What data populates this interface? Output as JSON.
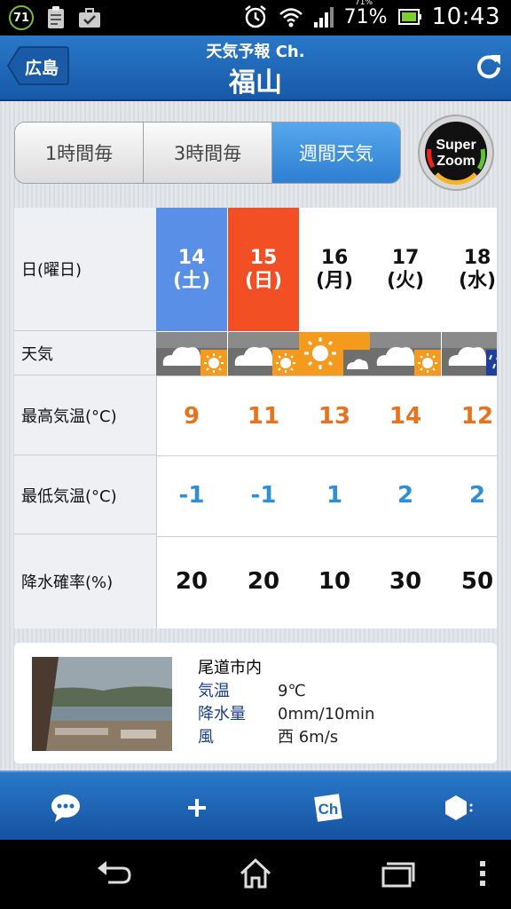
{
  "status_bar": {
    "badge": "71",
    "battery_small": "71%",
    "battery": "71%",
    "time": "10:43",
    "icons": [
      "clipboard-icon",
      "briefcase-check-icon",
      "alarm-icon",
      "wifi-icon",
      "signal-icon",
      "battery-icon"
    ]
  },
  "header": {
    "back_label": "広島",
    "subtitle": "天気予報 Ch.",
    "title": "福山"
  },
  "tabs": [
    {
      "label": "1時間毎",
      "active": false
    },
    {
      "label": "3時間毎",
      "active": false
    },
    {
      "label": "週間天気",
      "active": true
    }
  ],
  "super_zoom": {
    "line1": "Super",
    "line2": "Zoom"
  },
  "forecast": {
    "row_labels": {
      "day": "日(曜日)",
      "weather": "天気",
      "max_temp": "最高気温(°C)",
      "min_temp": "最低気温(°C)",
      "precip": "降水確率(%)"
    },
    "days": [
      {
        "date": "14",
        "dow": "(土)",
        "kind": "sat",
        "weather": "cloudy-then-sunny",
        "max": "9",
        "min": "-1",
        "precip": "20"
      },
      {
        "date": "15",
        "dow": "(日)",
        "kind": "sun",
        "weather": "cloudy-then-sunny",
        "max": "11",
        "min": "-1",
        "precip": "20"
      },
      {
        "date": "16",
        "dow": "(月)",
        "kind": "weekday",
        "weather": "sunny-then-cloudy",
        "max": "13",
        "min": "1",
        "precip": "10"
      },
      {
        "date": "17",
        "dow": "(火)",
        "kind": "weekday",
        "weather": "cloudy-then-sunny",
        "max": "14",
        "min": "2",
        "precip": "30"
      },
      {
        "date": "18",
        "dow": "(水)",
        "kind": "weekday",
        "weather": "cloudy-then-rain",
        "max": "12",
        "min": "2",
        "precip": "50"
      }
    ]
  },
  "live_camera": {
    "location": "尾道市内",
    "rows": [
      {
        "key": "気温",
        "value": "9℃"
      },
      {
        "key": "降水量",
        "value": "0mm/10min"
      },
      {
        "key": "風",
        "value": "西 6m/s"
      }
    ]
  },
  "toolbar": {
    "chat_icon": "chat-bubble-icon",
    "add_icon": "plus-icon",
    "channel_icon": "ch-icon",
    "ch_text": "Ch",
    "settings_icon": "hexagon-icon"
  },
  "colors": {
    "header_blue": "#1f6cbd",
    "saturday": "#5a8fe8",
    "sunday": "#f24f25",
    "max_temp": "#e8731f",
    "min_temp": "#2e8fd6"
  }
}
